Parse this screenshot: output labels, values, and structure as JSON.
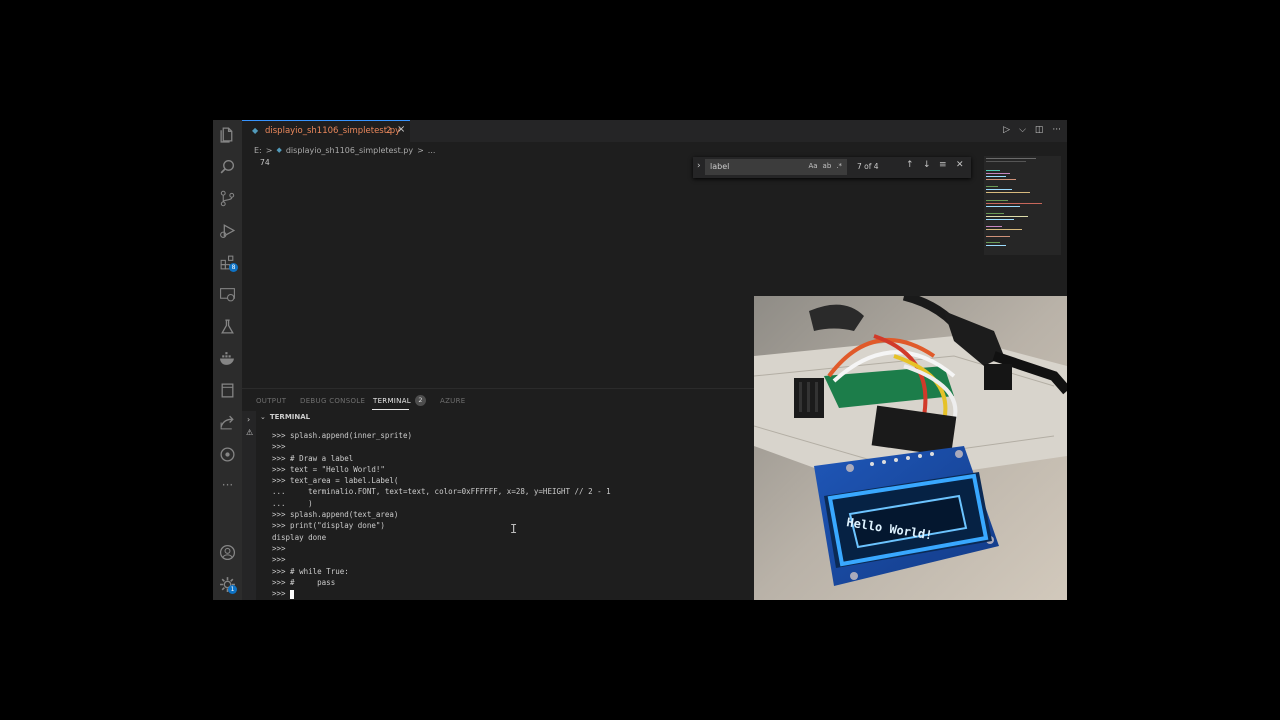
{
  "tab": {
    "filename": "displayio_sh1106_simpletest.py",
    "modified": "2",
    "close": "×"
  },
  "tabbar_actions": [
    "▷",
    "⌵",
    "◫",
    "···"
  ],
  "breadcrumb": {
    "drive": "E:",
    "sep1": ">",
    "file": "displayio_sh1106_simpletest.py",
    "sep2": ">",
    "more": "..."
  },
  "editor": {
    "line_number": "74"
  },
  "find": {
    "value": "label",
    "opts": [
      "Aa",
      "ab",
      ".*"
    ],
    "count": "7 of 4"
  },
  "activity_badges": {
    "extensions": "8",
    "settings": "1"
  },
  "panel": {
    "tabs": [
      "OUTPUT",
      "DEBUG CONSOLE",
      "TERMINAL",
      "AZURE"
    ],
    "terminal_badge": "2",
    "terminal_title": "TERMINAL"
  },
  "terminal": [
    ">>> splash.append(inner_sprite)",
    ">>>",
    ">>> # Draw a label",
    ">>> text = \"Hello World!\"",
    ">>> text_area = label.Label(",
    "...     terminalio.FONT, text=text, color=0xFFFFFF, x=28, y=HEIGHT // 2 - 1",
    "...     )",
    ">>> splash.append(text_area)",
    ">>> print(\"display done\")",
    "display done",
    ">>>",
    ">>>",
    ">>> # while True:",
    ">>> #     pass",
    ">>> "
  ],
  "oled": {
    "text": "Hello World!"
  },
  "colors": {
    "accent": "#3794ff",
    "modified_tab": "#e9875b",
    "oled_glow": "#39a8ff"
  }
}
